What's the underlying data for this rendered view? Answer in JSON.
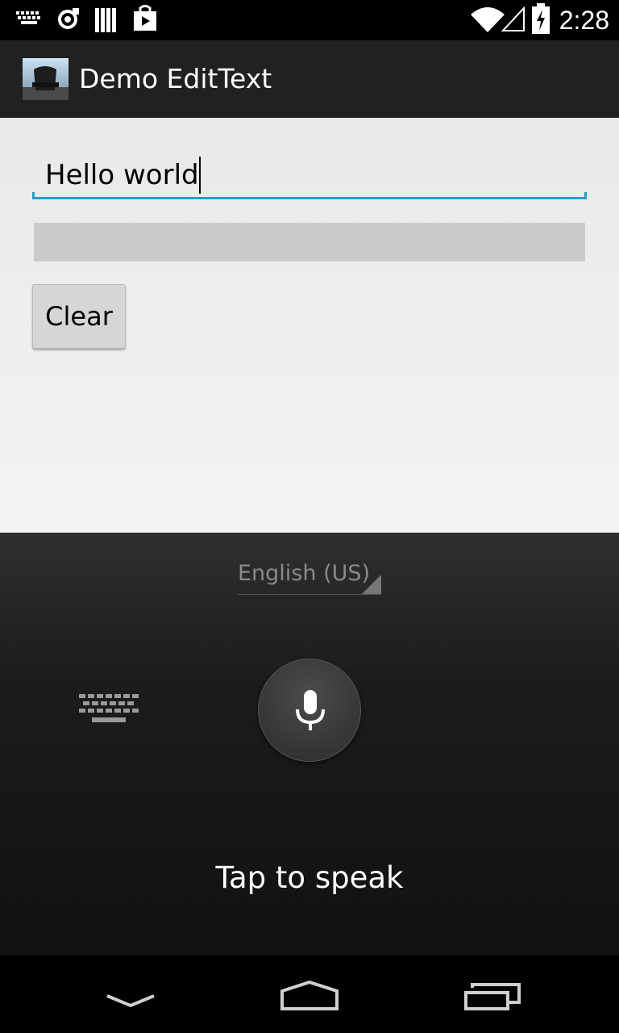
{
  "status_bar": {
    "time": "2:28",
    "icons": [
      "keyboard-icon",
      "sync-icon",
      "library-icon",
      "play-store-icon",
      "wifi-icon",
      "signal-icon",
      "battery-charging-icon"
    ]
  },
  "action_bar": {
    "title": "Demo EditText",
    "icon": "app-icon"
  },
  "content": {
    "edit_text_value": "Hello world",
    "clear_label": "Clear"
  },
  "voice_input": {
    "language": "English (US)",
    "prompt": "Tap to speak",
    "icons": [
      "keyboard-icon",
      "microphone-icon"
    ]
  },
  "nav_bar": {
    "icons": [
      "back-icon",
      "home-icon",
      "recents-icon"
    ]
  },
  "colors": {
    "accent": "#2a9dc1",
    "action_bar": "#212121",
    "content_bg": "#f1f1f1",
    "voice_bg": "#1c1c1c"
  }
}
